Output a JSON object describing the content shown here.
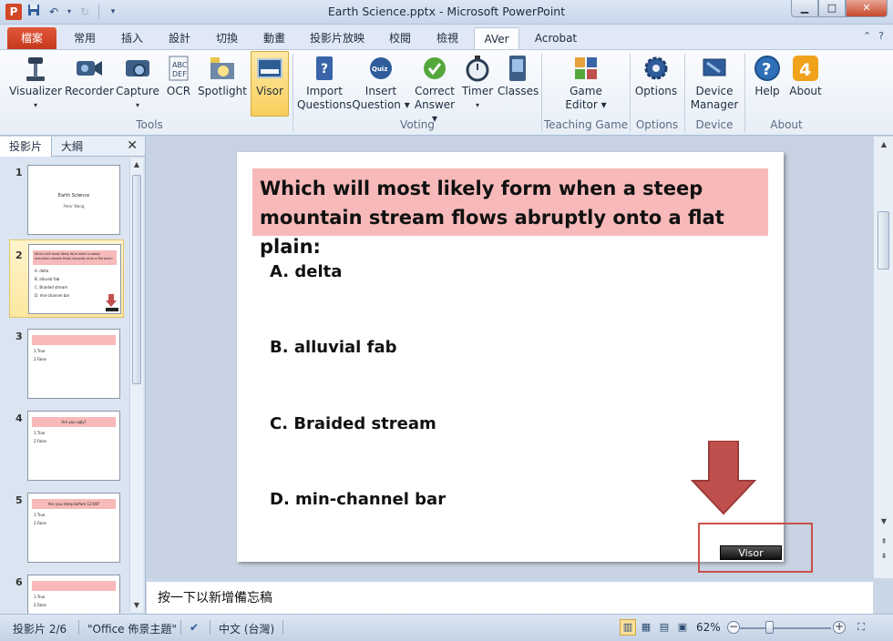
{
  "window": {
    "title": "Earth Science.pptx - Microsoft PowerPoint",
    "app_icon_letter": "P",
    "minimize": "▁",
    "maximize": "□",
    "close": "✕"
  },
  "tabs": [
    {
      "label": "檔案"
    },
    {
      "label": "常用"
    },
    {
      "label": "插入"
    },
    {
      "label": "設計"
    },
    {
      "label": "切換"
    },
    {
      "label": "動畫"
    },
    {
      "label": "投影片放映"
    },
    {
      "label": "校閱"
    },
    {
      "label": "檢視"
    },
    {
      "label": "AVer"
    },
    {
      "label": "Acrobat"
    }
  ],
  "ribbon": {
    "tools": {
      "label": "Tools",
      "buttons": [
        {
          "label": "Visualizer",
          "dropdown": "▾"
        },
        {
          "label": "Recorder"
        },
        {
          "label": "Capture",
          "dropdown": "▾"
        },
        {
          "label": "OCR"
        },
        {
          "label": "Spotlight"
        },
        {
          "label": "Visor"
        }
      ]
    },
    "voting": {
      "label": "Voting",
      "buttons": [
        {
          "label1": "Import",
          "label2": "Questions"
        },
        {
          "label1": "Insert",
          "label2": "Question ▾"
        },
        {
          "label1": "Correct",
          "label2": "Answer ▾"
        },
        {
          "label1": "Timer",
          "label2": "▾"
        },
        {
          "label1": "Classes",
          "label2": ""
        }
      ]
    },
    "teaching_game": {
      "label": "Teaching Game",
      "button1": "Game",
      "button2": "Editor ▾"
    },
    "options": {
      "label": "Options",
      "button": "Options"
    },
    "device": {
      "label": "Device",
      "button1": "Device",
      "button2": "Manager"
    },
    "about": {
      "label": "About",
      "help": "Help",
      "about": "About"
    }
  },
  "left_pane": {
    "tab_slides": "投影片",
    "tab_outline": "大綱",
    "close": "✕",
    "thumbs": [
      {
        "num": "1",
        "title": "Earth Science",
        "subtitle": "Peter Wang"
      },
      {
        "num": "2",
        "bar": "Which will most likely form when a steep mountain stream flows abruptly onto a flat plain:",
        "opts": [
          "A. delta",
          "B. alluvial fab",
          "C. Braided stream",
          "D. min-channel bar"
        ]
      },
      {
        "num": "3",
        "bar": "",
        "opts": [
          "1.True",
          "2.False"
        ]
      },
      {
        "num": "4",
        "bar": "Are you ugly?",
        "opts": [
          "1.True",
          "2.False"
        ]
      },
      {
        "num": "5",
        "bar": "Are you sleep before 12:00?",
        "opts": [
          "1.True",
          "2.False"
        ]
      },
      {
        "num": "6",
        "bar": "",
        "opts": [
          "1.True",
          "2.False"
        ]
      }
    ]
  },
  "slide": {
    "question": "Which will most likely form when a steep mountain stream flows abruptly onto a flat plain:",
    "options": [
      "A. delta",
      "B. alluvial fab",
      "C. Braided stream",
      "D. min-channel bar"
    ],
    "visor_button": "Visor",
    "question_bg": "#f7b9b9",
    "arrow_color": "#c0504d"
  },
  "notes_placeholder": "按一下以新增備忘稿",
  "status": {
    "slide_count": "投影片 2/6",
    "theme": "\"Office 佈景主題\"",
    "language": "中文 (台灣)",
    "zoom": "62%"
  }
}
